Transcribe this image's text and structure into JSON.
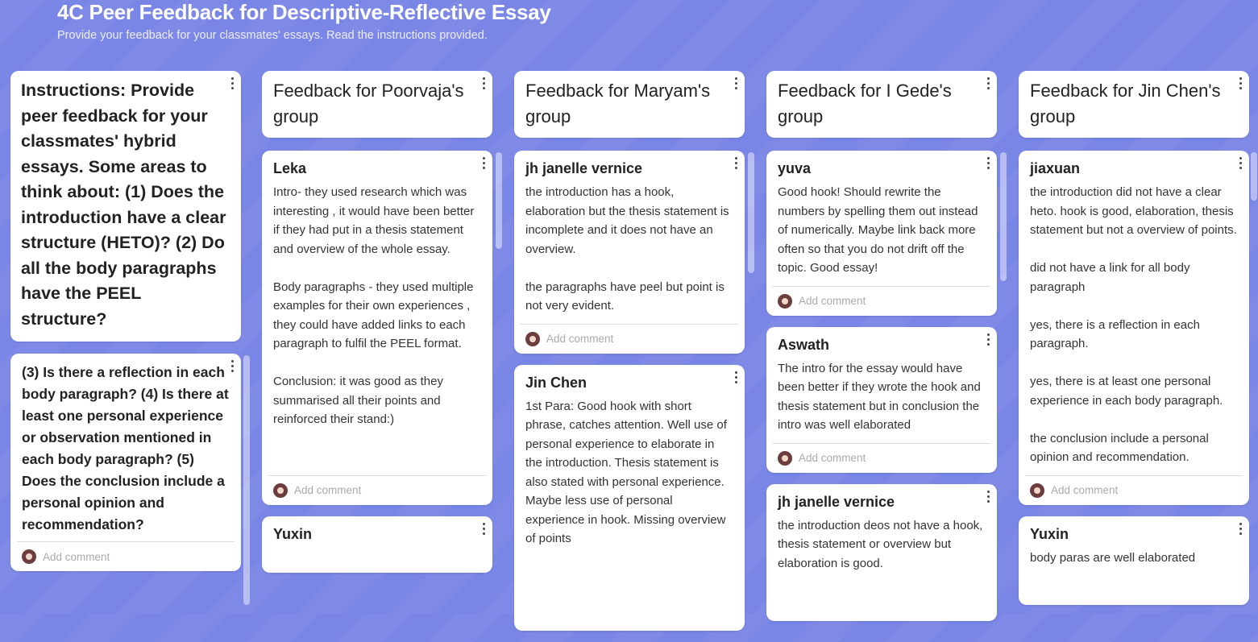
{
  "board": {
    "title": "4C Peer Feedback for Descriptive-Reflective Essay",
    "subtitle": "Provide your feedback for your classmates' essays. Read the instructions provided."
  },
  "add_comment_label": "Add comment",
  "columns": [
    {
      "header": "Instructions: Provide peer feedback for your classmates' hybrid essays. Some areas to think about: (1) Does the introduction have a clear structure (HETO)? (2) Do all the body paragraphs have the PEEL structure?",
      "cards": [
        {
          "author": "",
          "body": "(3) Is there a reflection in each body paragraph? (4) Is there at least one personal experience or observation mentioned in each body paragraph? (5) Does the conclusion include a personal opinion and recommendation?"
        }
      ]
    },
    {
      "header": "Feedback for Poorvaja's group",
      "cards": [
        {
          "author": "Leka",
          "body": "Intro-  they used research which was interesting , it would have been better if they had put in a thesis statement and overview of the whole essay.\n\nBody paragraphs - they used multiple examples for their own experiences , they could have added links to each paragraph to fulfil the PEEL format.\n\nConclusion: it was good as they summarised all their points and reinforced their stand:)\n\n\n"
        },
        {
          "author": "Yuxin",
          "body": ""
        }
      ]
    },
    {
      "header": "Feedback for Maryam's group",
      "cards": [
        {
          "author": "jh janelle vernice",
          "body": "the introduction has a hook, elaboration but the thesis statement is incomplete and it does not have an overview.\n\nthe paragraphs have peel but point is not very evident."
        },
        {
          "author": "Jin Chen",
          "body": "1st Para: Good hook with short phrase, catches attention. Well use of personal experience to elaborate in the introduction. Thesis statement is also stated with personal experience. Maybe less use of personal experience in hook. Missing overview of points"
        }
      ]
    },
    {
      "header": "Feedback for I Gede's group",
      "cards": [
        {
          "author": "yuva",
          "body": "Good hook! Should rewrite the numbers by spelling them out instead of numerically. Maybe link back more often so that you do not drift off the topic. Good essay!"
        },
        {
          "author": "Aswath",
          "body": "The intro for the essay would have been better if they wrote the hook and thesis statement but in conclusion the intro was well elaborated"
        },
        {
          "author": "jh janelle vernice",
          "body": "the introduction deos not have a hook, thesis statement or overview but elaboration is good."
        }
      ]
    },
    {
      "header": "Feedback for Jin Chen's group",
      "cards": [
        {
          "author": "jiaxuan",
          "body": "the introduction did not have a clear heto. hook is good, elaboration, thesis statement but not a overview of points.\n\ndid not have a link for all body paragraph\n\nyes, there is a reflection in each paragraph.\n\nyes, there is at least one personal experience in each body paragraph.\n\nthe conclusion include a personal opinion and recommendation."
        },
        {
          "author": "Yuxin",
          "body": "body paras are well elaborated"
        }
      ]
    }
  ]
}
